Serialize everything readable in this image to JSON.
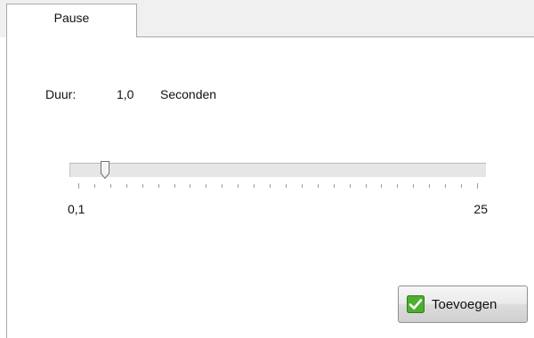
{
  "tabs": [
    {
      "label": "Pause",
      "active": true
    }
  ],
  "duration": {
    "label": "Duur:",
    "value": "1,0",
    "unit": "Seconden"
  },
  "slider": {
    "min_label": "0,1",
    "max_label": "25",
    "min": 0.1,
    "max": 25,
    "value": 1.0,
    "tick_count": 26
  },
  "actions": {
    "add_label": "Toevoegen",
    "add_icon": "check-icon"
  },
  "colors": {
    "check_green": "#4caf2e",
    "track": "#e6e6e6"
  }
}
